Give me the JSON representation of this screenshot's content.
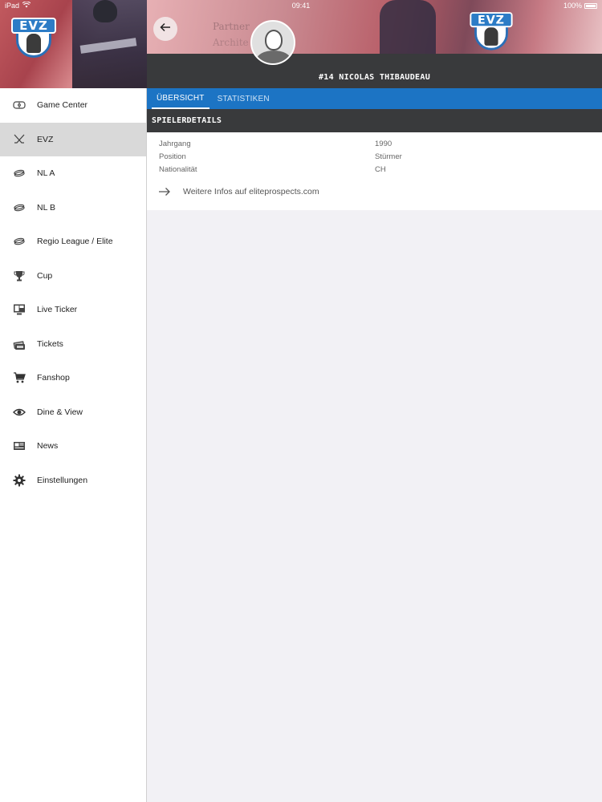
{
  "status_bar": {
    "device": "iPad",
    "time": "09:41",
    "battery": "100%"
  },
  "sidebar": {
    "logo_text": "EVZ",
    "items": [
      {
        "label": "Game Center",
        "icon": "rink-icon",
        "active": false
      },
      {
        "label": "EVZ",
        "icon": "crossed-sticks-icon",
        "active": true
      },
      {
        "label": "NL A",
        "icon": "puck-icon",
        "active": false
      },
      {
        "label": "NL B",
        "icon": "puck-icon",
        "active": false
      },
      {
        "label": "Regio League / Elite",
        "icon": "puck-icon",
        "active": false
      },
      {
        "label": "Cup",
        "icon": "trophy-icon",
        "active": false
      },
      {
        "label": "Live Ticker",
        "icon": "monitor-icon",
        "active": false
      },
      {
        "label": "Tickets",
        "icon": "ticket-icon",
        "active": false
      },
      {
        "label": "Fanshop",
        "icon": "cart-icon",
        "active": false
      },
      {
        "label": "Dine & View",
        "icon": "eye-icon",
        "active": false
      },
      {
        "label": "News",
        "icon": "newspaper-icon",
        "active": false
      },
      {
        "label": "Einstellungen",
        "icon": "gear-icon",
        "active": false
      }
    ]
  },
  "header": {
    "sponsor_text_1": "Partner",
    "sponsor_text_2": "Archite",
    "player_title": "#14 NICOLAS THIBAUDEAU",
    "logo_text": "EVZ"
  },
  "tabs": [
    {
      "label": "ÜBERSICHT",
      "active": true
    },
    {
      "label": "STATISTIKEN",
      "active": false
    }
  ],
  "section": {
    "title": "SPIELERDETAILS"
  },
  "details": [
    {
      "label": "Jahrgang",
      "value": "1990"
    },
    {
      "label": "Position",
      "value": "Stürmer"
    },
    {
      "label": "Nationalität",
      "value": "CH"
    }
  ],
  "more_link": {
    "label": "Weitere Infos auf eliteprospects.com"
  },
  "colors": {
    "tab_bar": "#1c74c4",
    "dark_bar": "#393a3c",
    "active_nav": "#d9d9d9",
    "background": "#f2f1f5"
  }
}
